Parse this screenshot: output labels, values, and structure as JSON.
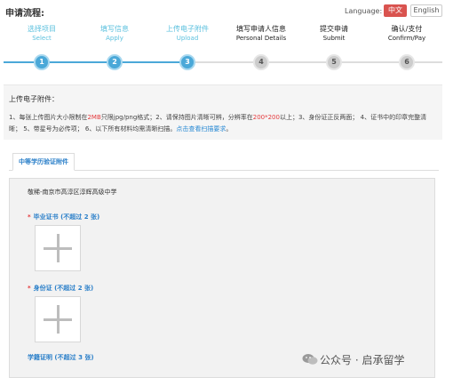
{
  "header": {
    "title": "申请流程:",
    "language_label": "Language:",
    "lang_zh": "中文",
    "lang_en": "English"
  },
  "steps": [
    {
      "label": "选择项目",
      "sub": "Select",
      "num": "1",
      "state": "done"
    },
    {
      "label": "填写信息",
      "sub": "Apply",
      "num": "2",
      "state": "done"
    },
    {
      "label": "上传电子附件",
      "sub": "Upload",
      "num": "3",
      "state": "done"
    },
    {
      "label": "填写申请人信息",
      "sub": "Personal Details",
      "num": "4",
      "state": "todo"
    },
    {
      "label": "提交申请",
      "sub": "Submit",
      "num": "5",
      "state": "todo"
    },
    {
      "label": "确认/支付",
      "sub": "Confirm/Pay",
      "num": "6",
      "state": "todo"
    }
  ],
  "info": {
    "title": "上传电子附件：",
    "text_1": "1、每张上传图片大小限制在",
    "text_red_1": "2MB",
    "text_2": "只限jpg/png格式；2、请保持图片清晰可辨，分辨率在",
    "text_red_2": "200*200",
    "text_3": "以上；3、身份证正反两面； 4、证书中的印章完整清晰； 5、带星号为必传项； 6、以下所有材料均需清晰扫描。",
    "text_link": "点击查看扫描要求",
    "text_end": "。"
  },
  "tabs": [
    {
      "label": "中等学历验证附件"
    }
  ],
  "panel": {
    "school": "敬稀-南京市高淳区淳辉高级中学",
    "docs": [
      {
        "label": "毕业证书 (不超过 2 张)",
        "required": true
      },
      {
        "label": "身份证 (不超过 2 张)",
        "required": true
      },
      {
        "label": "学籍证明 (不超过 3 张)",
        "required": false
      }
    ],
    "star": "*"
  },
  "watermark": {
    "text": "公众号 · 启承留学"
  },
  "colors": {
    "accent": "#4aa8d8",
    "done_text": "#5bc0de",
    "link": "#2a7fc9",
    "danger": "#e4393c",
    "lang_active": "#d9534f"
  }
}
